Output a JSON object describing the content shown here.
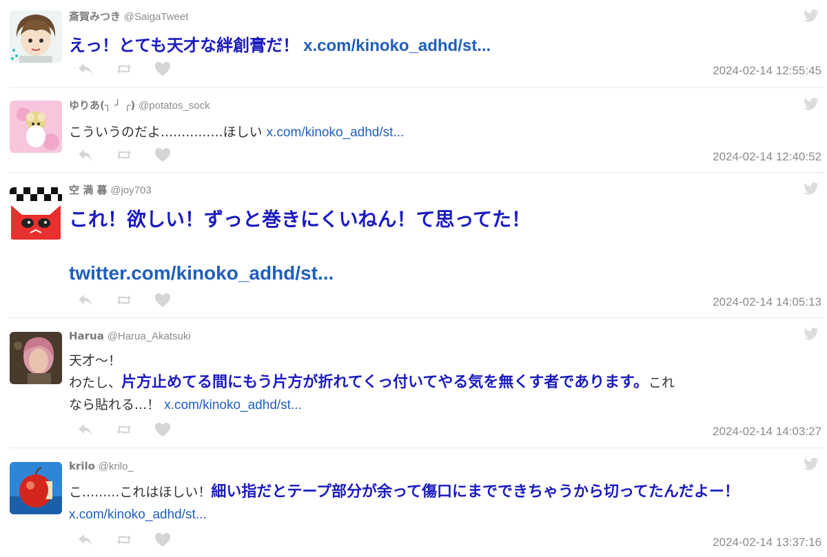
{
  "tweets": [
    {
      "user": "斎賀みつき",
      "handle": "@SaigaTweet",
      "text_big": "えっ！とても天才な絆創膏だ！",
      "link": "x.com/kinoko_adhd/st...",
      "timestamp": "2024-02-14 12:55:45"
    },
    {
      "user": "ゆりあ(╮ ╯ ╭)",
      "handle": "@potatos_sock",
      "text": "こういうのだよ...............ほしい",
      "link": "x.com/kinoko_adhd/st...",
      "timestamp": "2024-02-14 12:40:52"
    },
    {
      "user": "空 満 暮",
      "handle": "@joy703",
      "text_big": "これ！欲しい！ずっと巻きにくいねん！て思ってた！",
      "link": "twitter.com/kinoko_adhd/st...",
      "timestamp": "2024-02-14 14:05:13"
    },
    {
      "user": "Harua",
      "handle": "@Harua_Akatsuki",
      "line1": "天才〜！",
      "line2_prefix": "わたし、",
      "line2_emph": "片方止めてる間にもう片方が折れてくっ付いてやる気を無くす者であります。",
      "line2_suffix": "これ",
      "line3": "なら貼れる...！",
      "link": "x.com/kinoko_adhd/st...",
      "timestamp": "2024-02-14 14:03:27"
    },
    {
      "user": "krilo",
      "handle": "@krilo_",
      "text_prefix": "こ.........これはほしい！",
      "text_emph": "細い指だとテープ部分が余って傷口にまでできちゃうから切ってたんだよー！",
      "link": "x.com/kinoko_adhd/st...",
      "timestamp": "2024-02-14 13:37:16"
    }
  ],
  "icons": {
    "service": "twitter-bird-icon",
    "reply": "reply-icon",
    "retweet": "retweet-icon",
    "like": "heart-icon"
  },
  "colors": {
    "emphasis": "#1a1ac0",
    "link": "#1f5fbd",
    "muted": "#8a8a8a",
    "icon": "#d8d8d8"
  }
}
